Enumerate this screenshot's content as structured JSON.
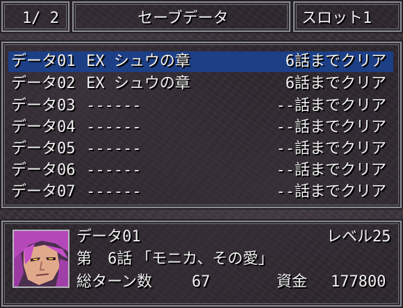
{
  "header": {
    "page": "1/ 2",
    "title": "セーブデータ",
    "slot": "スロット1"
  },
  "save_list": {
    "selected_index": 0,
    "rows": [
      {
        "name": "データ01",
        "scenario": "EX シュウの章",
        "progress": "6話までクリア"
      },
      {
        "name": "データ02",
        "scenario": "EX シュウの章",
        "progress": "6話までクリア"
      },
      {
        "name": "データ03",
        "scenario": "------",
        "progress": "--話までクリア"
      },
      {
        "name": "データ04",
        "scenario": "------",
        "progress": "--話までクリア"
      },
      {
        "name": "データ05",
        "scenario": "------",
        "progress": "--話までクリア"
      },
      {
        "name": "データ06",
        "scenario": "------",
        "progress": "--話までクリア"
      },
      {
        "name": "データ07",
        "scenario": "------",
        "progress": "--話までクリア"
      }
    ]
  },
  "detail": {
    "name": "データ01",
    "level_label": "レベル",
    "level_value": "25",
    "chapter_prefix": "第",
    "chapter_number": "6話",
    "chapter_title": "「モニカ、その愛」",
    "turns_label": "総ターン数",
    "turns_value": "67",
    "funds_label": "資金",
    "funds_value": "177800",
    "portrait_icon": "character-portrait-purple-hair"
  },
  "colors": {
    "selection": "#1c3f86",
    "frame": "#8d8e94",
    "text": "#f2f2f2"
  }
}
